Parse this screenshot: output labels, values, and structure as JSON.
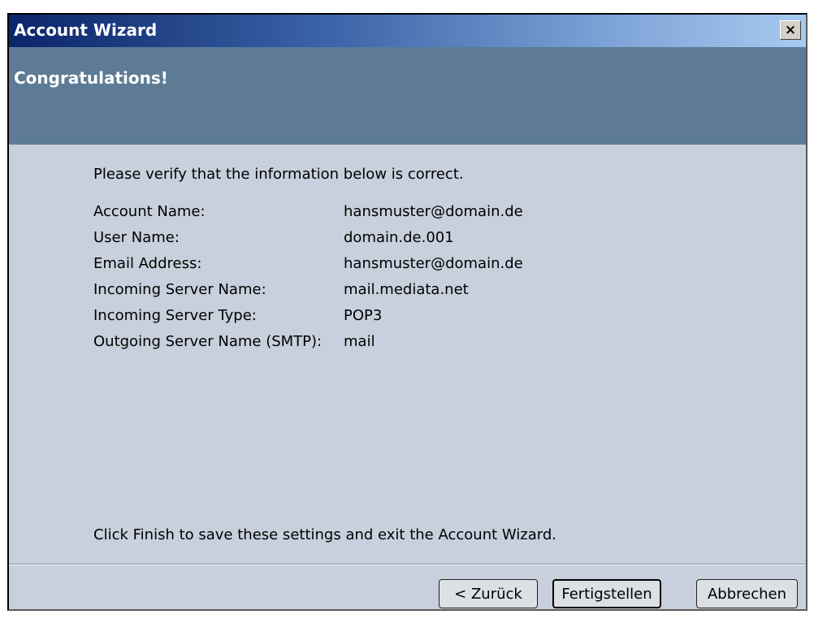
{
  "window": {
    "title": "Account Wizard",
    "close_label": "×"
  },
  "banner": {
    "title": "Congratulations!"
  },
  "content": {
    "intro": "Please verify that the information below is correct.",
    "rows": [
      {
        "label": "Account Name:",
        "value": "hansmuster@domain.de"
      },
      {
        "label": "User Name:",
        "value": "domain.de.001"
      },
      {
        "label": "Email Address:",
        "value": "hansmuster@domain.de"
      },
      {
        "label": "Incoming Server Name:",
        "value": "mail.mediata.net"
      },
      {
        "label": "Incoming Server Type:",
        "value": "POP3"
      },
      {
        "label": "Outgoing Server Name (SMTP):",
        "value": "mail"
      }
    ],
    "footer": "Click Finish to save these settings and exit the Account Wizard."
  },
  "buttons": {
    "back": "< Zurück",
    "finish": "Fertigstellen",
    "cancel": "Abbrechen"
  },
  "colors": {
    "titlebar_start": "#0a246a",
    "titlebar_end": "#a6caf0",
    "banner": "#5d7b95",
    "content_bg": "#c7d0dc"
  },
  "icons": {
    "close": "close-icon"
  }
}
